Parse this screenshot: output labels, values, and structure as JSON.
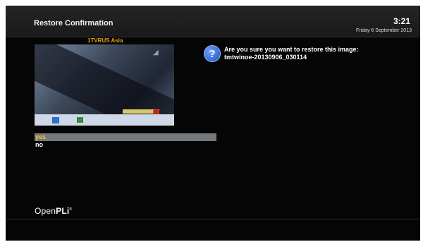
{
  "window": {
    "title": "Restore Confirmation",
    "time": "3:21",
    "date": "Friday 6 September 2013"
  },
  "preview": {
    "channel_name": "1TVRUS Asia"
  },
  "dialog": {
    "icon": "question-icon",
    "icon_glyph": "?",
    "message_line1": "Are you sure you want to restore this image:",
    "message_line2": "tmtwinoe-20130906_030114",
    "options": [
      "yes",
      "no"
    ],
    "selected_option": "yes"
  },
  "branding": {
    "logo_part1": "Open",
    "logo_part2": "PLi",
    "logo_mark": "®"
  },
  "colors": {
    "selected_text": "#f3c13a",
    "selected_bg": "#75797e",
    "channel_text": "#e8a21e",
    "background": "#050505"
  }
}
